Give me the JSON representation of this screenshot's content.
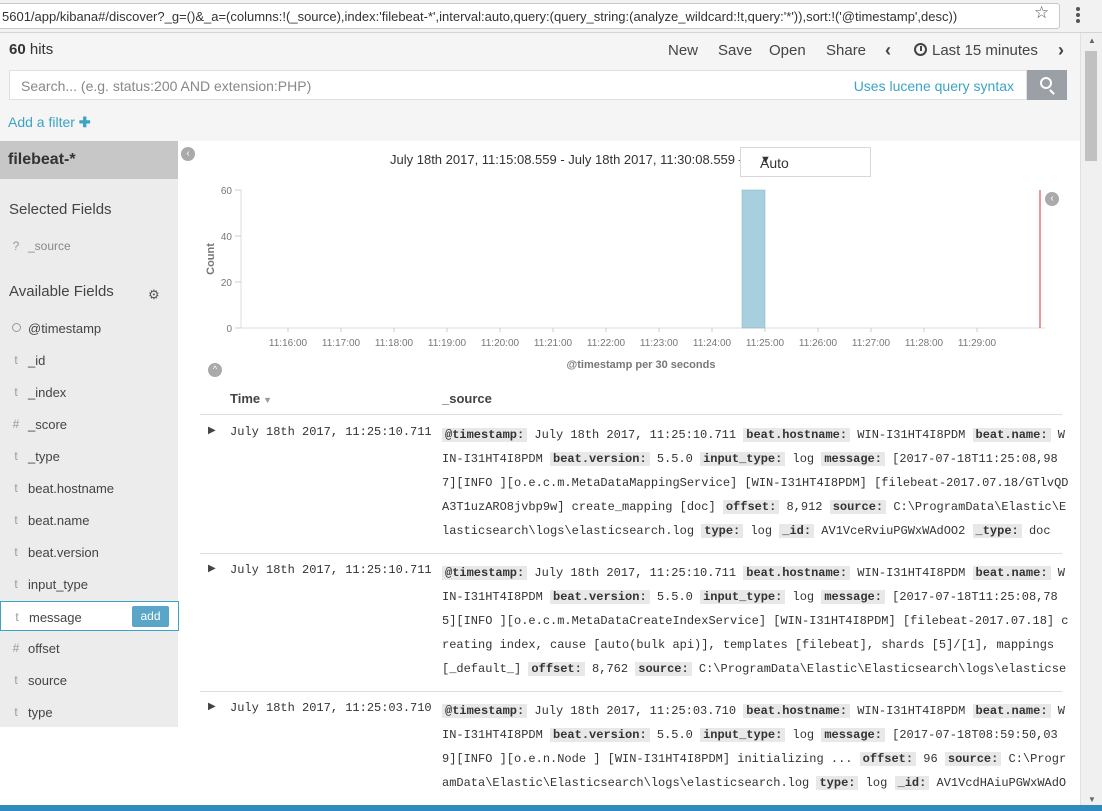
{
  "browser": {
    "url": "5601/app/kibana#/discover?_g=()&_a=(columns:!(_source),index:'filebeat-*',interval:auto,query:(query_string:(analyze_wildcard:!t,query:'*')),sort:!('@timestamp',desc))"
  },
  "topnav": {
    "hits_count": "60",
    "hits_label": "hits",
    "new": "New",
    "save": "Save",
    "open": "Open",
    "share": "Share",
    "time": "Last 15 minutes"
  },
  "search": {
    "placeholder": "Search... (e.g. status:200 AND extension:PHP)",
    "syntax_link": "Uses lucene query syntax"
  },
  "filter": {
    "add_label": "Add a filter"
  },
  "sidebar": {
    "index_pattern": "filebeat-*",
    "selected_header": "Selected Fields",
    "selected": [
      {
        "type": "?",
        "name": "_source"
      }
    ],
    "available_header": "Available Fields",
    "available": [
      {
        "type": "clock",
        "name": "@timestamp"
      },
      {
        "type": "t",
        "name": "_id"
      },
      {
        "type": "t",
        "name": "_index"
      },
      {
        "type": "#",
        "name": "_score"
      },
      {
        "type": "t",
        "name": "_type"
      },
      {
        "type": "t",
        "name": "beat.hostname"
      },
      {
        "type": "t",
        "name": "beat.name"
      },
      {
        "type": "t",
        "name": "beat.version"
      },
      {
        "type": "t",
        "name": "input_type"
      },
      {
        "type": "t",
        "name": "message"
      },
      {
        "type": "#",
        "name": "offset"
      },
      {
        "type": "t",
        "name": "source"
      },
      {
        "type": "t",
        "name": "type"
      }
    ],
    "add_button": "add"
  },
  "histogram": {
    "range_text": "July 18th 2017, 11:15:08.559 - July 18th 2017, 11:30:08.559 —",
    "interval": "Auto"
  },
  "chart_data": {
    "type": "bar",
    "ylabel": "Count",
    "xlabel": "@timestamp per 30 seconds",
    "ylim": [
      0,
      60
    ],
    "yticks": [
      "0",
      "20",
      "40",
      "60"
    ],
    "xticks": [
      "11:16:00",
      "11:17:00",
      "11:18:00",
      "11:19:00",
      "11:20:00",
      "11:21:00",
      "11:22:00",
      "11:23:00",
      "11:24:00",
      "11:25:00",
      "11:26:00",
      "11:27:00",
      "11:28:00",
      "11:29:00"
    ],
    "bars": [
      {
        "x": "11:25:00",
        "value": 60
      }
    ],
    "bar_color": "#a8cfdd",
    "now_marker_color": "#e57373"
  },
  "table": {
    "col_time": "Time",
    "col_source": "_source",
    "rows": [
      {
        "time": "July 18th 2017, 11:25:10.711",
        "lines": [
          [
            [
              "k",
              "@timestamp:"
            ],
            [
              "v",
              " July 18th 2017, 11:25:10.711 "
            ],
            [
              "k",
              "beat.hostname:"
            ],
            [
              "v",
              " WIN-I31HT4I8PDM "
            ],
            [
              "k",
              "beat.name:"
            ],
            [
              "v",
              " W"
            ]
          ],
          [
            [
              "v",
              "IN-I31HT4I8PDM "
            ],
            [
              "k",
              "beat.version:"
            ],
            [
              "v",
              " 5.5.0 "
            ],
            [
              "k",
              "input_type:"
            ],
            [
              "v",
              " log "
            ],
            [
              "k",
              "message:"
            ],
            [
              "v",
              " [2017-07-18T11:25:08,98"
            ]
          ],
          [
            [
              "v",
              "7][INFO ][o.e.c.m.MetaDataMappingService] [WIN-I31HT4I8PDM] [filebeat-2017.07.18/GTlvQD"
            ]
          ],
          [
            [
              "v",
              "A3T1uzARO8jvbp9w] create_mapping [doc] "
            ],
            [
              "k",
              "offset:"
            ],
            [
              "v",
              " 8,912 "
            ],
            [
              "k",
              "source:"
            ],
            [
              "v",
              " C:\\ProgramData\\Elastic\\E"
            ]
          ],
          [
            [
              "v",
              "lasticsearch\\logs\\elasticsearch.log "
            ],
            [
              "k",
              "type:"
            ],
            [
              "v",
              " log "
            ],
            [
              "k",
              "_id:"
            ],
            [
              "v",
              " AV1VceRviuPGWxWAdOO2 "
            ],
            [
              "k",
              "_type:"
            ],
            [
              "v",
              " doc"
            ]
          ]
        ]
      },
      {
        "time": "July 18th 2017, 11:25:10.711",
        "lines": [
          [
            [
              "k",
              "@timestamp:"
            ],
            [
              "v",
              " July 18th 2017, 11:25:10.711 "
            ],
            [
              "k",
              "beat.hostname:"
            ],
            [
              "v",
              " WIN-I31HT4I8PDM "
            ],
            [
              "k",
              "beat.name:"
            ],
            [
              "v",
              " W"
            ]
          ],
          [
            [
              "v",
              "IN-I31HT4I8PDM "
            ],
            [
              "k",
              "beat.version:"
            ],
            [
              "v",
              " 5.5.0 "
            ],
            [
              "k",
              "input_type:"
            ],
            [
              "v",
              " log "
            ],
            [
              "k",
              "message:"
            ],
            [
              "v",
              " [2017-07-18T11:25:08,78"
            ]
          ],
          [
            [
              "v",
              "5][INFO ][o.e.c.m.MetaDataCreateIndexService] [WIN-I31HT4I8PDM] [filebeat-2017.07.18] c"
            ]
          ],
          [
            [
              "v",
              "reating index, cause [auto(bulk api)], templates [filebeat], shards [5]/[1], mappings"
            ]
          ],
          [
            [
              "v",
              "[_default_] "
            ],
            [
              "k",
              "offset:"
            ],
            [
              "v",
              " 8,762 "
            ],
            [
              "k",
              "source:"
            ],
            [
              "v",
              " C:\\ProgramData\\Elastic\\Elasticsearch\\logs\\elasticse"
            ]
          ]
        ]
      },
      {
        "time": "July 18th 2017, 11:25:03.710",
        "lines": [
          [
            [
              "k",
              "@timestamp:"
            ],
            [
              "v",
              " July 18th 2017, 11:25:03.710 "
            ],
            [
              "k",
              "beat.hostname:"
            ],
            [
              "v",
              " WIN-I31HT4I8PDM "
            ],
            [
              "k",
              "beat.name:"
            ],
            [
              "v",
              " W"
            ]
          ],
          [
            [
              "v",
              "IN-I31HT4I8PDM "
            ],
            [
              "k",
              "beat.version:"
            ],
            [
              "v",
              " 5.5.0 "
            ],
            [
              "k",
              "input_type:"
            ],
            [
              "v",
              " log "
            ],
            [
              "k",
              "message:"
            ],
            [
              "v",
              " [2017-07-18T08:59:50,03"
            ]
          ],
          [
            [
              "v",
              "9][INFO ][o.e.n.Node ] [WIN-I31HT4I8PDM] initializing ... "
            ],
            [
              "k",
              "offset:"
            ],
            [
              "v",
              " 96 "
            ],
            [
              "k",
              "source:"
            ],
            [
              "v",
              " C:\\Progr"
            ]
          ],
          [
            [
              "v",
              "amData\\Elastic\\Elasticsearch\\logs\\elasticsearch.log "
            ],
            [
              "k",
              "type:"
            ],
            [
              "v",
              " log "
            ],
            [
              "k",
              "_id:"
            ],
            [
              "v",
              " AV1VcdHAiuPGWxWAdO"
            ]
          ]
        ]
      }
    ]
  }
}
